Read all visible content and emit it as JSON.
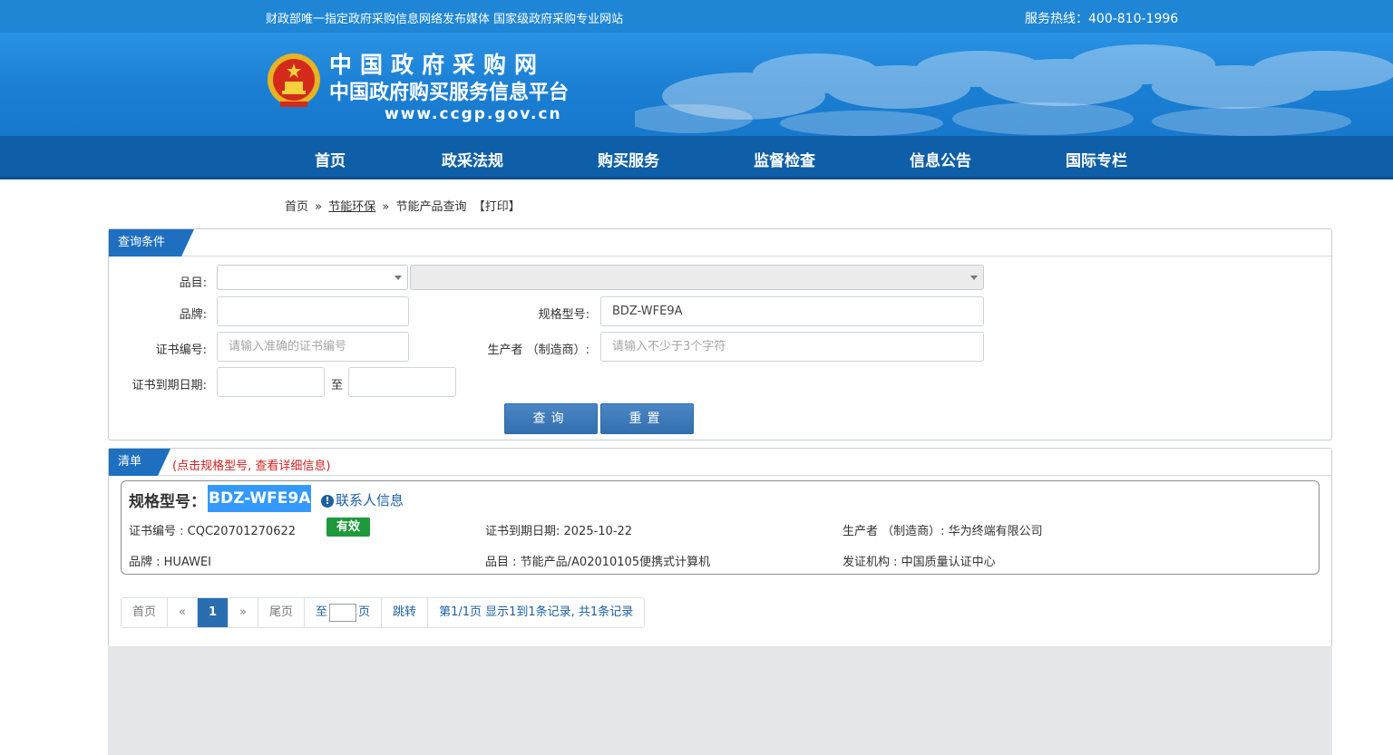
{
  "topbar": {
    "slogan": "财政部唯一指定政府采购信息网络发布媒体 国家级政府采购专业网站",
    "hotline": "服务热线：400-810-1996"
  },
  "banner": {
    "title": "中国政府采购网",
    "subtitle": "中国政府购买服务信息平台",
    "url": "www.ccgp.gov.cn",
    "emblem_icon": "national-emblem-icon"
  },
  "nav": {
    "items": [
      "首页",
      "政采法规",
      "购买服务",
      "监督检查",
      "信息公告",
      "国际专栏"
    ]
  },
  "breadcrumb": {
    "home": "首页",
    "sep1": "»",
    "category": "节能环保",
    "sep2": "»",
    "current": "节能产品查询",
    "print": "【打印】"
  },
  "query": {
    "tab_label": "查询条件",
    "category_label": "品目:",
    "brand_label": "品牌:",
    "brand_value": "",
    "model_label": "规格型号:",
    "model_value": "BDZ-WFE9A",
    "cert_label": "证书编号:",
    "cert_placeholder": "请输入准确的证书编号",
    "maker_label": "生产者 （制造商）:",
    "maker_placeholder": "请输入不少于3个字符",
    "expire_label": "证书到期日期:",
    "to_label": "至",
    "search_button": "查询",
    "reset_button": "重置"
  },
  "list": {
    "tab_label": "清单",
    "hint": "(点击规格型号, 查看详细信息)",
    "item": {
      "model_label": "规格型号：",
      "model_value": "BDZ-WFE9A",
      "contact_link": "联系人信息",
      "cert_no": "证书编号 : CQC20701270622",
      "status": "有效",
      "expire": "证书到期日期: 2025-10-22",
      "maker": "生产者 （制造商）: 华为终端有限公司",
      "brand": "品牌 : HUAWEI",
      "category": "品目 : 节能产品/A02010105便携式计算机",
      "issuer": "发证机构 : 中国质量认证中心"
    }
  },
  "pager": {
    "first": "首页",
    "prev": "«",
    "current": "1",
    "next": "»",
    "last": "尾页",
    "goto_prefix": "至",
    "goto_suffix": "页",
    "jump": "跳转",
    "summary": "第1/1页  显示1到1条记录, 共1条记录"
  },
  "colors": {
    "topbar": "#1f86d6",
    "nav": "#0f5fa8",
    "tab": "#1e6fc0",
    "status_green": "#1e9a3c",
    "highlight": "#3399ff"
  }
}
